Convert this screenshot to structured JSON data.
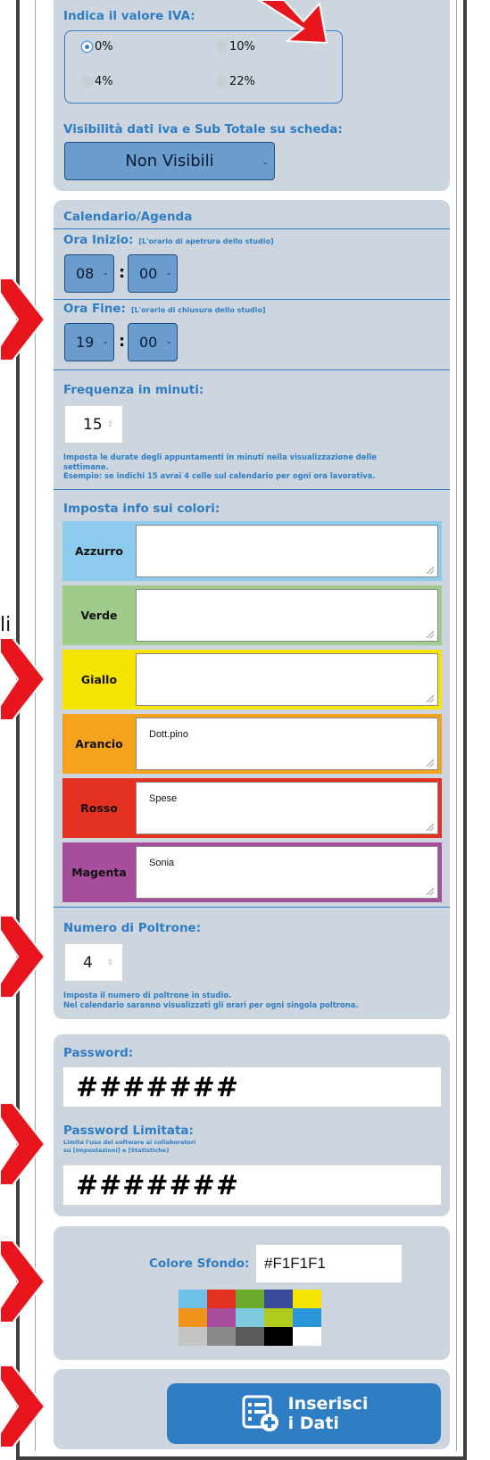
{
  "iva": {
    "label": "Indica il valore IVA:",
    "options": [
      {
        "label": "0%",
        "selected": true
      },
      {
        "label": "10%",
        "selected": false
      },
      {
        "label": "4%",
        "selected": false
      },
      {
        "label": "22%",
        "selected": false
      }
    ]
  },
  "visibility": {
    "label": "Visibilità dati iva e Sub Totale su scheda:",
    "selected": "Non Visibili"
  },
  "calendar": {
    "title": "Calendario/Agenda",
    "start": {
      "label": "Ora Inizio:",
      "hint": "[L'orario di apetrura dello studio]",
      "hour": "08",
      "minute": "00"
    },
    "end": {
      "label": "Ora Fine:",
      "hint": "[L'orario di chiusura dello studio]",
      "hour": "19",
      "minute": "00"
    },
    "frequency": {
      "label": "Frequenza in minuti:",
      "value": "15",
      "note_line1": "Imposta le durate degli appuntamenti in minuti nella visualizzazione delle",
      "note_line2": "settimane.",
      "note_line3": "Esempio: se indichi 15 avrai 4 celle sul calendario per ogni ora lavorativa."
    },
    "colors_label": "Imposta info sui colori:",
    "colors": [
      {
        "name": "Azzurro",
        "value": "",
        "bg": "#8dcbee",
        "text": "#111111"
      },
      {
        "name": "Verde",
        "value": "",
        "bg": "#a1cb8a",
        "text": "#111111"
      },
      {
        "name": "Giallo",
        "value": "",
        "bg": "#f5e400",
        "text": "#111111"
      },
      {
        "name": "Arancio",
        "value": "Dott.pino",
        "bg": "#f5a21c",
        "text": "#111111"
      },
      {
        "name": "Rosso",
        "value": "Spese",
        "bg": "#e3301f",
        "text": "#111111"
      },
      {
        "name": "Magenta",
        "value": "Sonia",
        "bg": "#a84c9c",
        "text": "#111111"
      }
    ],
    "chairs": {
      "label": "Numero di Poltrone:",
      "value": "4",
      "note_line1": "Imposta il numero di poltrone in studio.",
      "note_line2": "Nel calendario saranno visualizzati gli orari per ogni singola poltrona."
    }
  },
  "password": {
    "label": "Password:",
    "value": "#######",
    "limited_label": "Password Limitata:",
    "limited_hint1": "Limita l'uso del software ai collaboratori",
    "limited_hint2": "su [Impostazioni] e [Statistiche]",
    "limited_value": "#######"
  },
  "background": {
    "label": "Colore Sfondo:",
    "value": "#F1F1F1",
    "palette": [
      "#6ec0e8",
      "#e3301f",
      "#6aab2c",
      "#3a4a9a",
      "#f5e400",
      "#f0921c",
      "#a84c9c",
      "#7ecbe0",
      "#b2cc1e",
      "#2a96d8",
      "#c4c4c4",
      "#8a8a8a",
      "#5a5a5a",
      "#000000",
      "#ffffff"
    ]
  },
  "submit": {
    "line1": "Inserisci",
    "line2": "i Dati"
  },
  "side_fragment": "li",
  "accent": "#2e7dc4",
  "arrow_color": "#e8151c"
}
